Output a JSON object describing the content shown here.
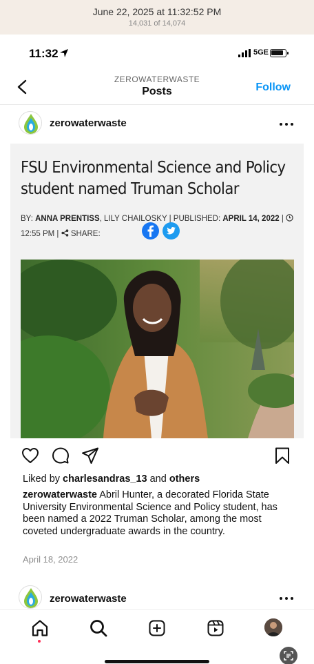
{
  "photo_meta": {
    "date": "June 22, 2025 at 11:32:52 PM",
    "count": "14,031 of 14,074"
  },
  "status_bar": {
    "time": "11:32",
    "network": "5GE"
  },
  "nav": {
    "subtitle": "ZEROWATERWASTE",
    "title": "Posts",
    "follow_label": "Follow"
  },
  "post": {
    "username": "zerowaterwaste",
    "article": {
      "headline": "FSU Environmental Science and Policy student named Truman Scholar",
      "by_label": "BY:",
      "author1": "ANNA PRENTISS",
      "author2": ", LILY CHAILOSKY | PUBLISHED:",
      "published": "APRIL 14, 2022",
      "time": "12:55 PM",
      "share_label": "SHARE:"
    },
    "likes_prefix": "Liked by",
    "liked_by": "charlesandras_13",
    "likes_and": "and",
    "likes_others": "others",
    "caption_user": "zerowaterwaste",
    "caption_text": "Abril Hunter, a decorated Florida State University Environmental Science and Policy student, has been named a 2022 Truman Scholar, among the most coveted undergraduate awards in the country.",
    "date": "April 18, 2022"
  },
  "next_post": {
    "username": "zerowaterwaste"
  },
  "colors": {
    "accent": "#0a95f6",
    "facebook": "#1877f2",
    "twitter": "#1d9bf0",
    "notification_dot": "#ff2d55"
  },
  "icons": {
    "actions": [
      "heart-icon",
      "comment-icon",
      "share-icon",
      "bookmark-icon"
    ],
    "tabs": [
      "home-icon",
      "search-icon",
      "create-icon",
      "reels-icon",
      "profile-avatar"
    ]
  }
}
